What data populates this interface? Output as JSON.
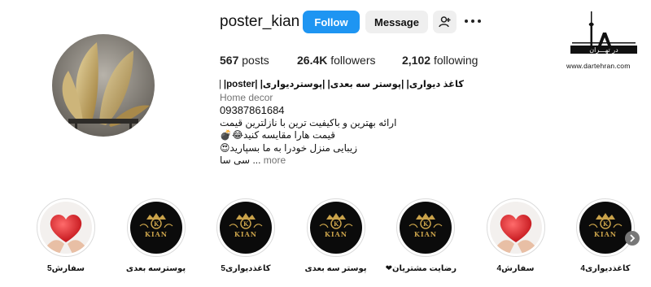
{
  "profile": {
    "username": "poster_kian",
    "follow_label": "Follow",
    "message_label": "Message",
    "suggest_icon": "person-plus-icon",
    "more_icon": "more-horizontal-icon"
  },
  "stats": {
    "posts_count": "567",
    "posts_label": "posts",
    "followers_count": "26.4K",
    "followers_label": "followers",
    "following_count": "2,102",
    "following_label": "following"
  },
  "bio": {
    "name": "کاغذ دیواری| |پوستر سه بعدی| |پوستردیواری| |poster| |(تهران)|",
    "category": "Home decor",
    "phone": "09387861684",
    "line1": "ارائه بهترین و باکیفیت ترین با نازلترین قیمت",
    "line2": "قیمت هارا مقایسه کنید😂💣",
    "line3": "زیبایی منزل خودرا به ما بسپارید😍",
    "line4": "سی سا ...",
    "more_label": "more"
  },
  "watermark": {
    "logo_text": "در تهـــران",
    "url": "www.dartehran.com"
  },
  "highlights": [
    {
      "label": "سفارش5",
      "image": "heart"
    },
    {
      "label": "پوسترسه بعدی",
      "image": "kian"
    },
    {
      "label": "کاغذدیواری5",
      "image": "kian"
    },
    {
      "label": "پوستر سه بعدی",
      "image": "kian"
    },
    {
      "label": "رضایت مشتریان❤",
      "image": "kian"
    },
    {
      "label": "سفارش4",
      "image": "heart"
    },
    {
      "label": "کاغذدیواری4",
      "image": "kian"
    }
  ],
  "colors": {
    "follow_button": "#1e95f2",
    "secondary_button": "#efefef",
    "muted_text": "#737373",
    "kian_gold": "#c9a24a"
  }
}
